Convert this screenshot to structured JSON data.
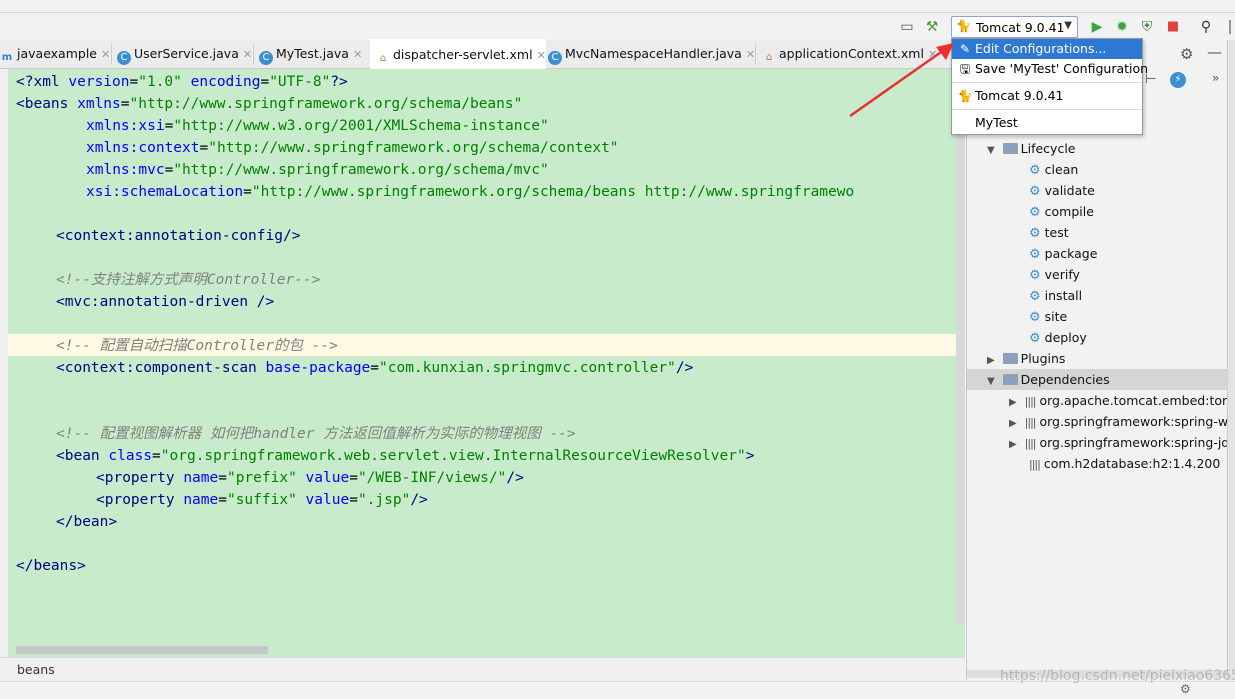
{
  "toolbar": {
    "run_config_label": "Tomcat 9.0.41",
    "icons": [
      "layout-icon",
      "build-hammer-icon",
      "tomcat-icon",
      "run-icon",
      "debug-icon",
      "coverage-icon",
      "stop-icon",
      "search-icon"
    ]
  },
  "tabs": [
    {
      "label": "javaexample",
      "icon": "maven-m-icon"
    },
    {
      "label": "UserService.java",
      "icon": "class-icon"
    },
    {
      "label": "MyTest.java",
      "icon": "class-icon"
    },
    {
      "label": "dispatcher-servlet.xml",
      "icon": "xml-icon",
      "active": true
    },
    {
      "label": "MvcNamespaceHandler.java",
      "icon": "class-icon"
    },
    {
      "label": "applicationContext.xml",
      "icon": "xml-icon"
    }
  ],
  "code": {
    "l1": {
      "a": "<?",
      "b": "xml ",
      "c": "version",
      "d": "=",
      "e": "\"1.0\" ",
      "f": "encoding",
      "g": "=",
      "h": "\"UTF-8\"",
      "i": "?>"
    },
    "l2": {
      "a": "<beans ",
      "b": "xmlns",
      "c": "=",
      "d": "\"http://www.springframework.org/schema/beans\""
    },
    "l3": {
      "a": "xmlns:xsi",
      "b": "=",
      "c": "\"http://www.w3.org/2001/XMLSchema-instance\""
    },
    "l4": {
      "a": "xmlns:context",
      "b": "=",
      "c": "\"http://www.springframework.org/schema/context\""
    },
    "l5": {
      "a": "xmlns:mvc",
      "b": "=",
      "c": "\"http://www.springframework.org/schema/mvc\""
    },
    "l6": {
      "a": "xsi:schemaLocation",
      "b": "=",
      "c": "\"http://www.springframework.org/schema/beans http://www.springframewo"
    },
    "l8": {
      "a": "<context:annotation-config/>"
    },
    "l10": {
      "a": "<!--支持注解方式声明Controller-->"
    },
    "l11": {
      "a": "<mvc:annotation-driven />"
    },
    "l13": {
      "a": "<!-- 配置自动扫描Controller的包 -->"
    },
    "l14": {
      "a": "<context:component-scan ",
      "b": "base-package",
      "c": "=",
      "d": "\"com.kunxian.springmvc.controller\"",
      "e": "/>"
    },
    "l17": {
      "a": "<!-- 配置视图解析器 如何把handler 方法返回值解析为实际的物理视图 -->"
    },
    "l18": {
      "a": "<bean ",
      "b": "class",
      "c": "=",
      "d": "\"org.springframework.web.servlet.view.InternalResourceViewResolver\"",
      "e": ">"
    },
    "l19": {
      "a": "<property ",
      "b": "name",
      "c": "=",
      "d": "\"prefix\" ",
      "e": "value",
      "f": "=",
      "g": "\"/WEB-INF/views/\"",
      "h": "/>"
    },
    "l20": {
      "a": "<property ",
      "b": "name",
      "c": "=",
      "d": "\"suffix\" ",
      "e": "value",
      "f": "=",
      "g": "\".jsp\"",
      "h": "/>"
    },
    "l21": {
      "a": "</bean>"
    },
    "l23": {
      "a": "</beans>"
    }
  },
  "breadcrumb": "beans",
  "dropdown": {
    "items": [
      {
        "label": "Edit Configurations...",
        "icon": "edit-icon",
        "selected": true
      },
      {
        "label": "Save 'MyTest' Configuration",
        "icon": "save-icon"
      },
      {
        "label": "Tomcat 9.0.41",
        "icon": "tomcat-icon"
      },
      {
        "label": "MyTest",
        "icon": "class-icon"
      }
    ]
  },
  "maven": {
    "lifecycle_label": "Lifecycle",
    "goals": [
      "clean",
      "validate",
      "compile",
      "test",
      "package",
      "verify",
      "install",
      "site",
      "deploy"
    ],
    "plugins_label": "Plugins",
    "dependencies_label": "Dependencies",
    "dependencies": [
      "org.apache.tomcat.embed:tomc",
      "org.springframework:spring-we",
      "org.springframework:spring-jd",
      "com.h2database:h2:1.4.200"
    ]
  },
  "watermark": "https://blog.csdn.net/pieixiao6365",
  "colors": {
    "editor_bg": "#c8eccb",
    "selection": "#2c78d4",
    "arrow": "#e8312f",
    "highlight_line": "#fffae3"
  }
}
